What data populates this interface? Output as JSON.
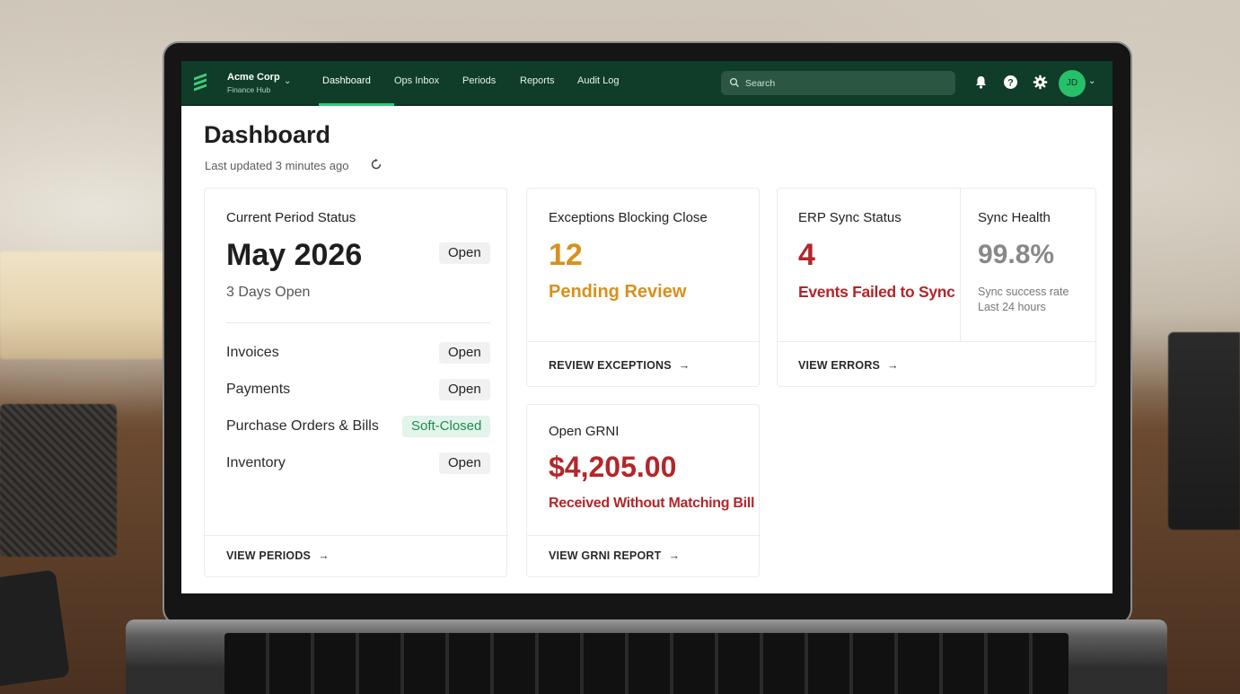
{
  "brand": {
    "org_name": "Acme Corp",
    "org_sub": "Finance Hub",
    "color_primary": "#0f3d2a",
    "color_accent": "#35c779"
  },
  "nav": {
    "tabs": [
      "Dashboard",
      "Ops Inbox",
      "Periods",
      "Reports",
      "Audit Log"
    ],
    "active_tab": "Dashboard"
  },
  "search": {
    "placeholder": "Search",
    "value": ""
  },
  "user": {
    "initials": "JD"
  },
  "header": {
    "title": "Dashboard",
    "last_updated": "Last updated 3 minutes ago"
  },
  "period_card": {
    "title": "Current Period Status",
    "period": "May 2026",
    "status": "Open",
    "days_open": "3 Days Open",
    "rows": [
      {
        "label": "Invoices",
        "status": "Open"
      },
      {
        "label": "Payments",
        "status": "Open"
      },
      {
        "label": "Purchase Orders & Bills",
        "status": "Soft-Closed"
      },
      {
        "label": "Inventory",
        "status": "Open"
      }
    ],
    "link": "VIEW PERIODS"
  },
  "exceptions_card": {
    "title": "Exceptions Blocking Close",
    "count": "12",
    "subtitle": "Pending Review",
    "color": "#d9901c",
    "link": "REVIEW EXCEPTIONS"
  },
  "erp_card": {
    "title": "ERP Sync Status",
    "count": "4",
    "subtitle": "Events Failed to Sync",
    "color": "#b3262b",
    "link": "VIEW ERRORS"
  },
  "sync_health": {
    "title": "Sync Health",
    "value": "99.8%",
    "caption_line1": "Sync success rate",
    "caption_line2": "Last 24 hours"
  },
  "grni_card": {
    "title": "Open GRNI",
    "amount": "$4,205.00",
    "subtitle": "Received Without Matching Bill",
    "color": "#b3262b",
    "link": "VIEW GRNI REPORT"
  }
}
